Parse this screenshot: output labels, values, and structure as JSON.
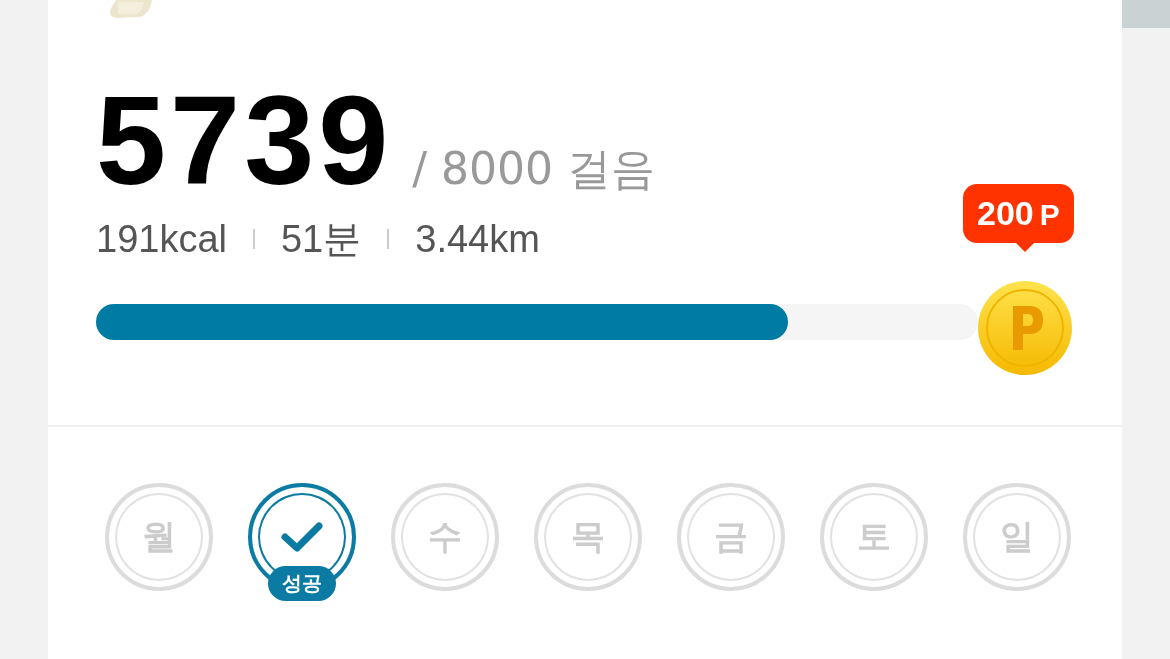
{
  "steps": {
    "count": "5739",
    "goal": "/ 8000 걸음"
  },
  "stats": [
    "191kcal",
    "51분",
    "3.44km"
  ],
  "progress": {
    "level": 0.785
  },
  "reward": {
    "points": "200",
    "unit": "P"
  },
  "days": [
    {
      "label": "월",
      "done": false
    },
    {
      "done": true,
      "badge": "성공"
    },
    {
      "label": "수",
      "done": false
    },
    {
      "label": "목",
      "done": false
    },
    {
      "label": "금",
      "done": false
    },
    {
      "label": "토",
      "done": false
    },
    {
      "label": "일",
      "done": false
    }
  ]
}
